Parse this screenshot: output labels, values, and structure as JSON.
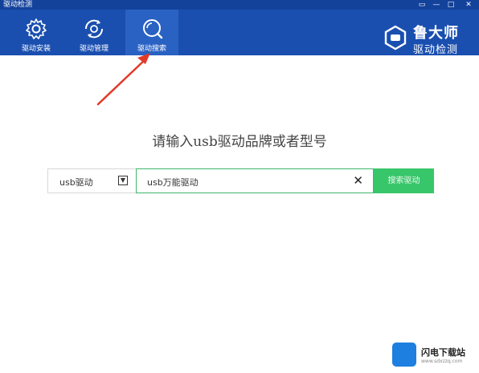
{
  "window": {
    "title": "驱动检测"
  },
  "toolbar": {
    "items": [
      {
        "label": "驱动安装"
      },
      {
        "label": "驱动管理"
      },
      {
        "label": "驱动搜索"
      }
    ]
  },
  "brand": {
    "line1": "鲁大师",
    "line2": "驱动检测"
  },
  "main": {
    "headline": "请输入usb驱动品牌或者型号",
    "category_select": {
      "value": "usb驱动"
    },
    "search_input": {
      "value": "usb万能驱动"
    },
    "search_button": "搜索驱动"
  },
  "watermark": {
    "name": "闪电下载站",
    "url": "www.sdxzzq.com"
  },
  "colors": {
    "toolbar_bg": "#1a4fb0",
    "accent_green": "#38c66b",
    "annotation_red": "#e23a2a"
  }
}
